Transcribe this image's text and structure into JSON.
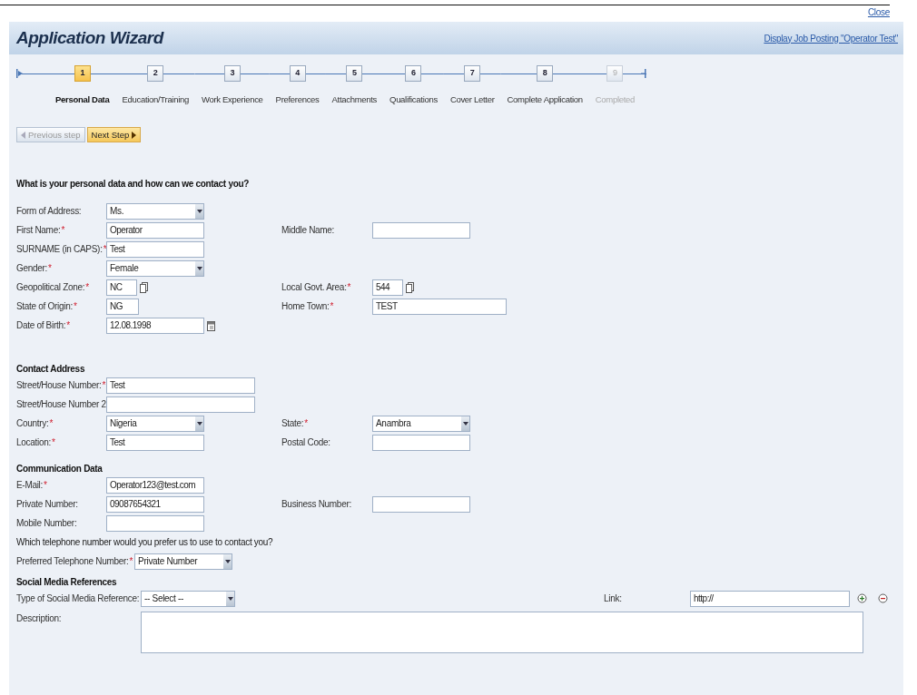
{
  "close_link": "Close",
  "header": {
    "title": "Application Wizard",
    "link": "Display Job Posting \"Operator Test\""
  },
  "steps": [
    {
      "number": "1",
      "label": "Personal Data",
      "selected": true,
      "disabled": false
    },
    {
      "number": "2",
      "label": "Education/Training",
      "selected": false,
      "disabled": false
    },
    {
      "number": "3",
      "label": "Work Experience",
      "selected": false,
      "disabled": false
    },
    {
      "number": "4",
      "label": "Preferences",
      "selected": false,
      "disabled": false
    },
    {
      "number": "5",
      "label": "Attachments",
      "selected": false,
      "disabled": false
    },
    {
      "number": "6",
      "label": "Qualifications",
      "selected": false,
      "disabled": false
    },
    {
      "number": "7",
      "label": "Cover Letter",
      "selected": false,
      "disabled": false
    },
    {
      "number": "8",
      "label": "Complete Application",
      "selected": false,
      "disabled": false
    },
    {
      "number": "9",
      "label": "Completed",
      "selected": false,
      "disabled": true
    }
  ],
  "nav_buttons": [
    {
      "label": "Previous step",
      "kind": "previous",
      "disabled": true
    },
    {
      "label": "Next Step",
      "kind": "next",
      "disabled": false
    }
  ],
  "sections": [
    {
      "heading": "What is your personal data and how can we contact you?",
      "rows": [
        {
          "kind": "pair",
          "fields": [
            {
              "label": "Form of Address:",
              "kind": "select",
              "value": "Ms."
            }
          ]
        },
        {
          "kind": "pair",
          "fields": [
            {
              "label": "First Name:",
              "mark": "*",
              "kind": "text",
              "value": "Operator"
            },
            {
              "label": "Middle Name:",
              "kind": "text"
            }
          ]
        },
        {
          "kind": "pair",
          "fields": [
            {
              "label": "SURNAME (in CAPS):",
              "mark": "*",
              "kind": "text",
              "value": "Test"
            }
          ]
        },
        {
          "kind": "pair",
          "fields": [
            {
              "label": "Gender:",
              "mark": "*",
              "kind": "select",
              "value": "Female"
            }
          ]
        },
        {
          "kind": "pair",
          "fields": [
            {
              "label": "Geopolitical Zone:",
              "mark": "*",
              "kind": "lookup",
              "value": "NC"
            },
            {
              "label": "Local Govt. Area:",
              "mark": "*",
              "kind": "lookup",
              "value": "544"
            }
          ]
        },
        {
          "kind": "pair",
          "fields": [
            {
              "label": "State of Origin:",
              "mark": "*",
              "kind": "text",
              "value": "NG"
            },
            {
              "label": "Home Town:",
              "mark": "*",
              "kind": "text",
              "value": "TEST"
            }
          ]
        },
        {
          "kind": "pair",
          "fields": [
            {
              "label": "Date of Birth:",
              "mark": "*",
              "kind": "date",
              "value": "12.08.1998"
            }
          ]
        }
      ]
    },
    {
      "heading": "Contact Address",
      "rows": [
        {
          "kind": "pair",
          "fields": [
            {
              "label": "Street/House Number:",
              "mark": "*",
              "kind": "text",
              "value": "Test"
            }
          ]
        },
        {
          "kind": "pair",
          "fields": [
            {
              "label": "Street/House Number 2:",
              "kind": "text"
            }
          ]
        },
        {
          "kind": "pair",
          "fields": [
            {
              "label": "Country:",
              "mark": "*",
              "kind": "select",
              "value": "Nigeria"
            },
            {
              "label": "State:",
              "mark": "*",
              "kind": "select",
              "value": "Anambra"
            }
          ]
        },
        {
          "kind": "pair",
          "fields": [
            {
              "label": "Location:",
              "mark": "*",
              "kind": "text",
              "value": "Test"
            },
            {
              "label": "Postal Code:",
              "kind": "text"
            }
          ]
        }
      ]
    },
    {
      "heading": "Communication Data",
      "rows": [
        {
          "kind": "pair",
          "fields": [
            {
              "label": "E-Mail:",
              "mark": "*",
              "kind": "text",
              "value": "Operator123@test.com"
            }
          ]
        },
        {
          "kind": "pair",
          "fields": [
            {
              "label": "Private Number:",
              "kind": "text",
              "value": "09087654321"
            },
            {
              "label": "Business Number:",
              "kind": "text"
            }
          ]
        },
        {
          "kind": "pair",
          "fields": [
            {
              "label": "Mobile Number:",
              "kind": "text"
            }
          ]
        },
        {
          "kind": "note",
          "text": "Which telephone number would you prefer us to use to contact you?"
        },
        {
          "kind": "inline",
          "fields": [
            {
              "label": "Preferred Telephone Number:",
              "mark": "*",
              "kind": "select",
              "value": "Private Number"
            }
          ]
        }
      ]
    },
    {
      "heading": "Social Media References",
      "rows": [
        {
          "kind": "social",
          "fields": [
            {
              "label": "Type of Social Media Reference:",
              "kind": "select",
              "value": "-- Select --"
            },
            {
              "label": "Link:",
              "kind": "text",
              "value": "http://"
            }
          ]
        },
        {
          "kind": "wide",
          "fields": [
            {
              "label": "Description:",
              "kind": "textarea"
            }
          ]
        }
      ]
    }
  ]
}
